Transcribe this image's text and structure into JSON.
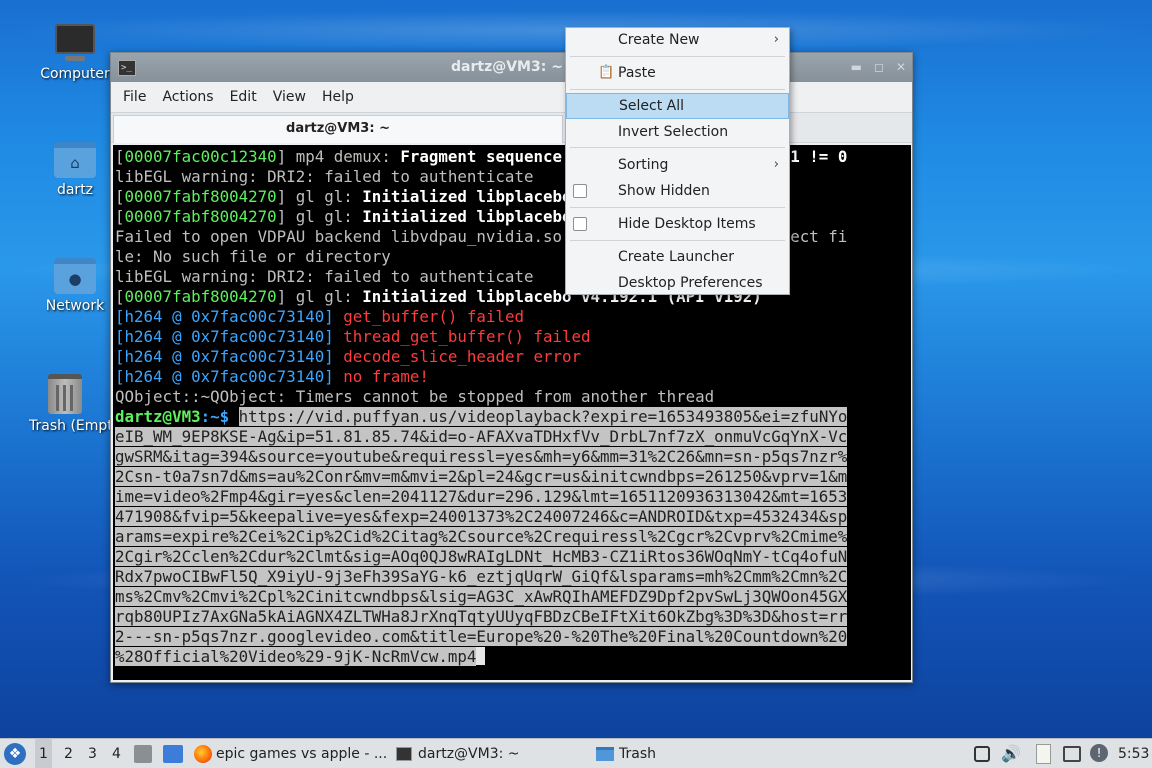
{
  "desktop": {
    "icons": [
      {
        "label": "Computer",
        "icon": "computer-icon"
      },
      {
        "label": "dartz",
        "icon": "home-folder-icon"
      },
      {
        "label": "Network",
        "icon": "network-folder-icon"
      },
      {
        "label": "Trash (Empty)",
        "icon": "trash-icon"
      }
    ]
  },
  "window": {
    "title": "dartz@VM3: ~",
    "menu": [
      "File",
      "Actions",
      "Edit",
      "View",
      "Help"
    ],
    "tab_title": "dartz@VM3: ~"
  },
  "terminal": {
    "lines": [
      {
        "addr": "00007fac00c12340",
        "mod": "mp4 demux: ",
        "msg": "Fragment sequence discontinuity detected 1 != 0"
      },
      {
        "plain": "libEGL warning: DRI2: failed to authenticate"
      },
      {
        "addr": "00007fabf8004270",
        "mod": "gl gl: ",
        "msg": "Initialized libplacebo v4.192.1 (API v192)"
      },
      {
        "addr": "00007fabf8004270",
        "mod": "gl gl: ",
        "msg": "Initialized libplacebo v4.192.1 (API v192)"
      },
      {
        "plain": "Failed to open VDPAU backend libvdpau_nvidia.so: cannot open shared object fi"
      },
      {
        "plain": "le: No such file or directory"
      },
      {
        "plain": "libEGL warning: DRI2: failed to authenticate"
      },
      {
        "addr": "00007fabf8004270",
        "mod": "gl gl: ",
        "msg": "Initialized libplacebo v4.192.1 (API v192)"
      },
      {
        "h264": "h264 @ 0x7fac00c73140",
        "err": "get_buffer() failed"
      },
      {
        "h264": "h264 @ 0x7fac00c73140",
        "err": "thread_get_buffer() failed"
      },
      {
        "h264": "h264 @ 0x7fac00c73140",
        "err": "decode_slice_header error"
      },
      {
        "h264": "h264 @ 0x7fac00c73140",
        "err": "no frame!"
      },
      {
        "plain": "QObject::~QObject: Timers cannot be stopped from another thread"
      }
    ],
    "prompt_user": "dartz@VM3",
    "prompt_path": ":~$",
    "selected_lines": [
      "https://vid.puffyan.us/videoplayback?expire=1653493805&ei=zfuNYo",
      "eIB_WM_9EP8KSE-Ag&ip=51.81.85.74&id=o-AFAXvaTDHxfVv_DrbL7nf7zX_onmuVcGqYnX-Vc",
      "gwSRM&itag=394&source=youtube&requiressl=yes&mh=y6&mm=31%2C26&mn=sn-p5qs7nzr%",
      "2Csn-t0a7sn7d&ms=au%2Conr&mv=m&mvi=2&pl=24&gcr=us&initcwndbps=261250&vprv=1&m",
      "ime=video%2Fmp4&gir=yes&clen=2041127&dur=296.129&lmt=1651120936313042&mt=1653",
      "471908&fvip=5&keepalive=yes&fexp=24001373%2C24007246&c=ANDROID&txp=4532434&sp",
      "arams=expire%2Cei%2Cip%2Cid%2Citag%2Csource%2Crequiressl%2Cgcr%2Cvprv%2Cmime%",
      "2Cgir%2Cclen%2Cdur%2Clmt&sig=AOq0QJ8wRAIgLDNt_HcMB3-CZ1iRtos36WOqNmY-tCq4ofuN",
      "Rdx7pwoCIBwFl5Q_X9iyU-9j3eFh39SaYG-k6_eztjqUqrW_GiQf&lsparams=mh%2Cmm%2Cmn%2C",
      "ms%2Cmv%2Cmvi%2Cpl%2Cinitcwndbps&lsig=AG3C_xAwRQIhAMEFDZ9Dpf2pvSwLj3QWOon45GX",
      "rqb80UPIz7AxGNa5kAiAGNX4ZLTWHa8JrXnqTqtyUUyqFBDzCBeIFtXit6OkZbg%3D%3D&host=rr",
      "2---sn-p5qs7nzr.googlevideo.com&title=Europe%20-%20The%20Final%20Countdown%20",
      "%28Official%20Video%29-9jK-NcRmVcw.mp4"
    ]
  },
  "context_menu": {
    "items": [
      {
        "label": "Create New",
        "submenu": true
      },
      {
        "label": "Paste",
        "icon": "paste-icon"
      },
      {
        "label": "Select All",
        "highlighted": true
      },
      {
        "label": "Invert Selection"
      },
      {
        "label": "Sorting",
        "submenu": true
      },
      {
        "label": "Show Hidden",
        "checkbox": true
      },
      {
        "label": "Hide Desktop Items",
        "checkbox": true
      },
      {
        "label": "Create Launcher"
      },
      {
        "label": "Desktop Preferences"
      }
    ]
  },
  "taskbar": {
    "desktops": [
      "1",
      "2",
      "3",
      "4"
    ],
    "tasks": [
      {
        "label": "epic games vs apple - ...",
        "icon": "firefox-icon"
      },
      {
        "label": "dartz@VM3: ~",
        "icon": "terminal-icon"
      },
      {
        "label": "Trash",
        "icon": "folder-icon"
      }
    ],
    "clock": "5:53"
  }
}
